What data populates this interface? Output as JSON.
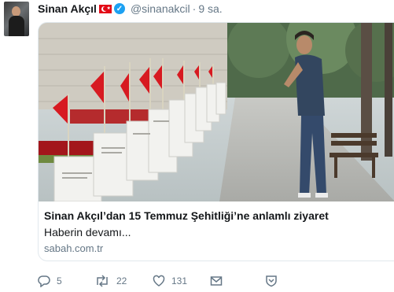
{
  "tweet": {
    "name": "Sinan Akçıl",
    "handle": "@sinanakcil",
    "separator": "·",
    "time": "9 sa.",
    "colors": {
      "accent": "#1da1f2",
      "muted": "#657786",
      "flag": "#e30a17"
    }
  },
  "card": {
    "title": "Sinan Akçıl’dan 15 Temmuz Şehitliği’ne anlamlı ziyaret",
    "description": "Haberin devamı...",
    "domain": "sabah.com.tr"
  },
  "actions": {
    "reply_count": "5",
    "retweet_count": "22",
    "like_count": "131",
    "icons": [
      "reply-icon",
      "retweet-icon",
      "like-icon",
      "message-icon",
      "bookmark-shield-icon"
    ]
  }
}
